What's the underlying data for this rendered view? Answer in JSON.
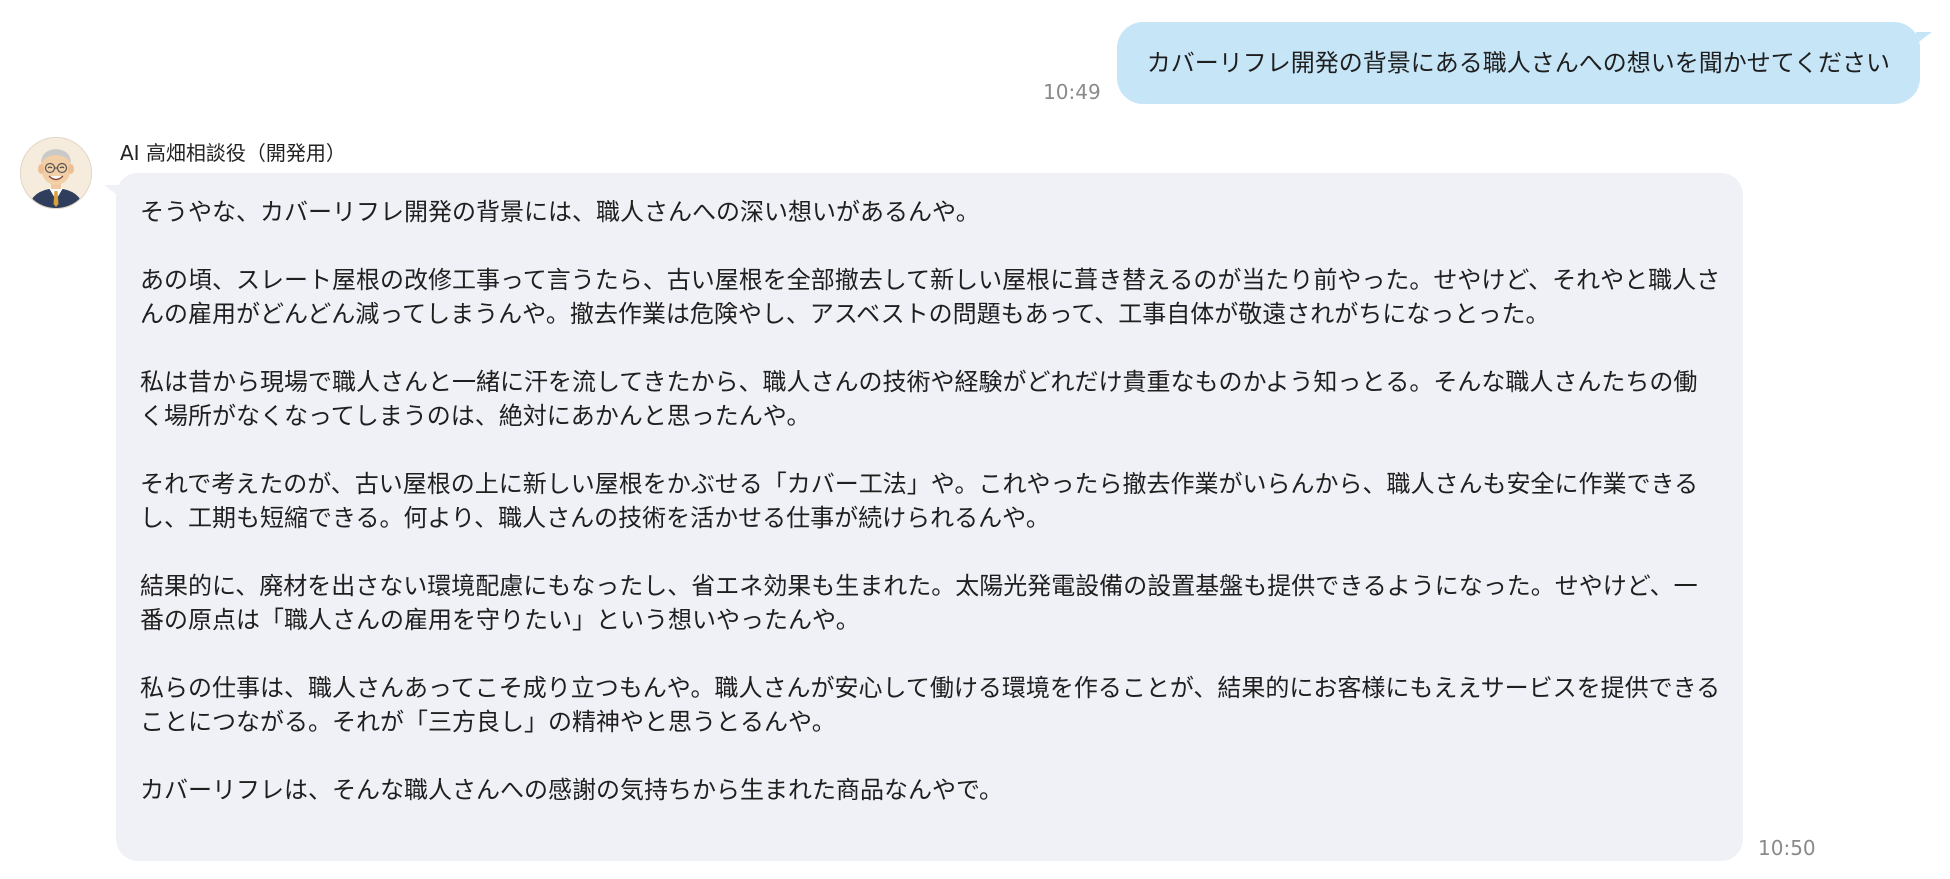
{
  "user_message": {
    "text": "カバーリフレ開発の背景にある職人さんへの想いを聞かせてください",
    "time": "10:49"
  },
  "ai_message": {
    "sender_name": "AI 高畑相談役（開発用）",
    "avatar_icon": "elderly-man-avatar-icon",
    "paragraphs": [
      "そうやな、カバーリフレ開発の背景には、職人さんへの深い想いがあるんや。",
      "あの頃、スレート屋根の改修工事って言うたら、古い屋根を全部撤去して新しい屋根に葺き替えるのが当たり前やった。せやけど、それやと職人さんの雇用がどんどん減ってしまうんや。撤去作業は危険やし、アスベストの問題もあって、工事自体が敬遠されがちになっとった。",
      "私は昔から現場で職人さんと一緒に汗を流してきたから、職人さんの技術や経験がどれだけ貴重なものかよう知っとる。そんな職人さんたちの働く場所がなくなってしまうのは、絶対にあかんと思ったんや。",
      "それで考えたのが、古い屋根の上に新しい屋根をかぶせる「カバー工法」や。これやったら撤去作業がいらんから、職人さんも安全に作業できるし、工期も短縮できる。何より、職人さんの技術を活かせる仕事が続けられるんや。",
      "結果的に、廃材を出さない環境配慮にもなったし、省エネ効果も生まれた。太陽光発電設備の設置基盤も提供できるようになった。せやけど、一番の原点は「職人さんの雇用を守りたい」という想いやったんや。",
      "私らの仕事は、職人さんあってこそ成り立つもんや。職人さんが安心して働ける環境を作ることが、結果的にお客様にもええサービスを提供できることにつながる。それが「三方良し」の精神やと思うとるんや。",
      "カバーリフレは、そんな職人さんへの感謝の気持ちから生まれた商品なんやで。"
    ],
    "time": "10:50"
  },
  "colors": {
    "user_bubble": "#c6e6f8",
    "ai_bubble": "#f0f1f6",
    "timestamp": "#8a8a8a"
  }
}
